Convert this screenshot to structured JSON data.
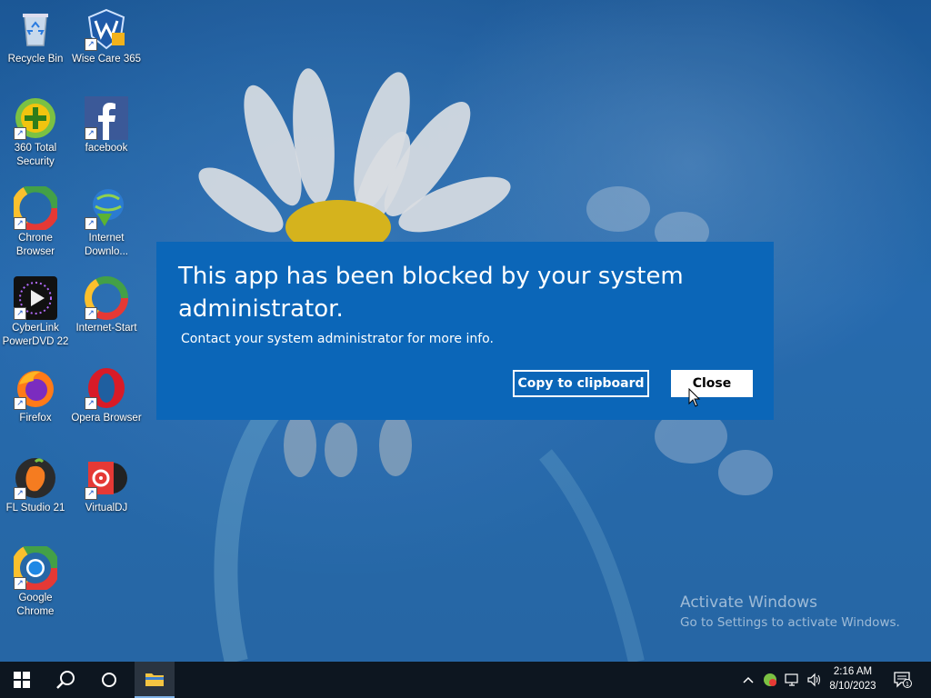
{
  "desktop": {
    "icons": [
      {
        "label": "Recycle Bin",
        "icon": "recycle-bin-icon"
      },
      {
        "label": "Wise Care 365",
        "icon": "wise-care-icon"
      },
      {
        "label": "360 Total Security",
        "icon": "security-360-icon"
      },
      {
        "label": "facebook",
        "icon": "facebook-icon"
      },
      {
        "label": "Chrone Browser",
        "icon": "chrone-browser-icon"
      },
      {
        "label": "Internet Downlo...",
        "icon": "internet-download-icon"
      },
      {
        "label": "CyberLink PowerDVD 22",
        "icon": "powerdvd-icon"
      },
      {
        "label": "Internet-Start",
        "icon": "internet-start-icon"
      },
      {
        "label": "Firefox",
        "icon": "firefox-icon"
      },
      {
        "label": "Opera Browser",
        "icon": "opera-icon"
      },
      {
        "label": "FL Studio 21",
        "icon": "fl-studio-icon"
      },
      {
        "label": "VirtualDJ",
        "icon": "virtualdj-icon"
      },
      {
        "label": "Google Chrome",
        "icon": "chrome-icon"
      }
    ]
  },
  "dialog": {
    "title": "This app has been blocked by your system administrator.",
    "message": "Contact your system administrator for more info.",
    "copy_label": "Copy to clipboard",
    "close_label": "Close",
    "background": "#0b66b8"
  },
  "watermark": {
    "line1": "Activate Windows",
    "line2": "Go to Settings to activate Windows."
  },
  "taskbar": {
    "start_icon": "windows-start-icon",
    "search_icon": "search-icon",
    "cortana_icon": "cortana-icon",
    "explorer_icon": "file-explorer-icon",
    "clock_time": "2:16 AM",
    "clock_date": "8/10/2023",
    "notification_count": "1"
  }
}
